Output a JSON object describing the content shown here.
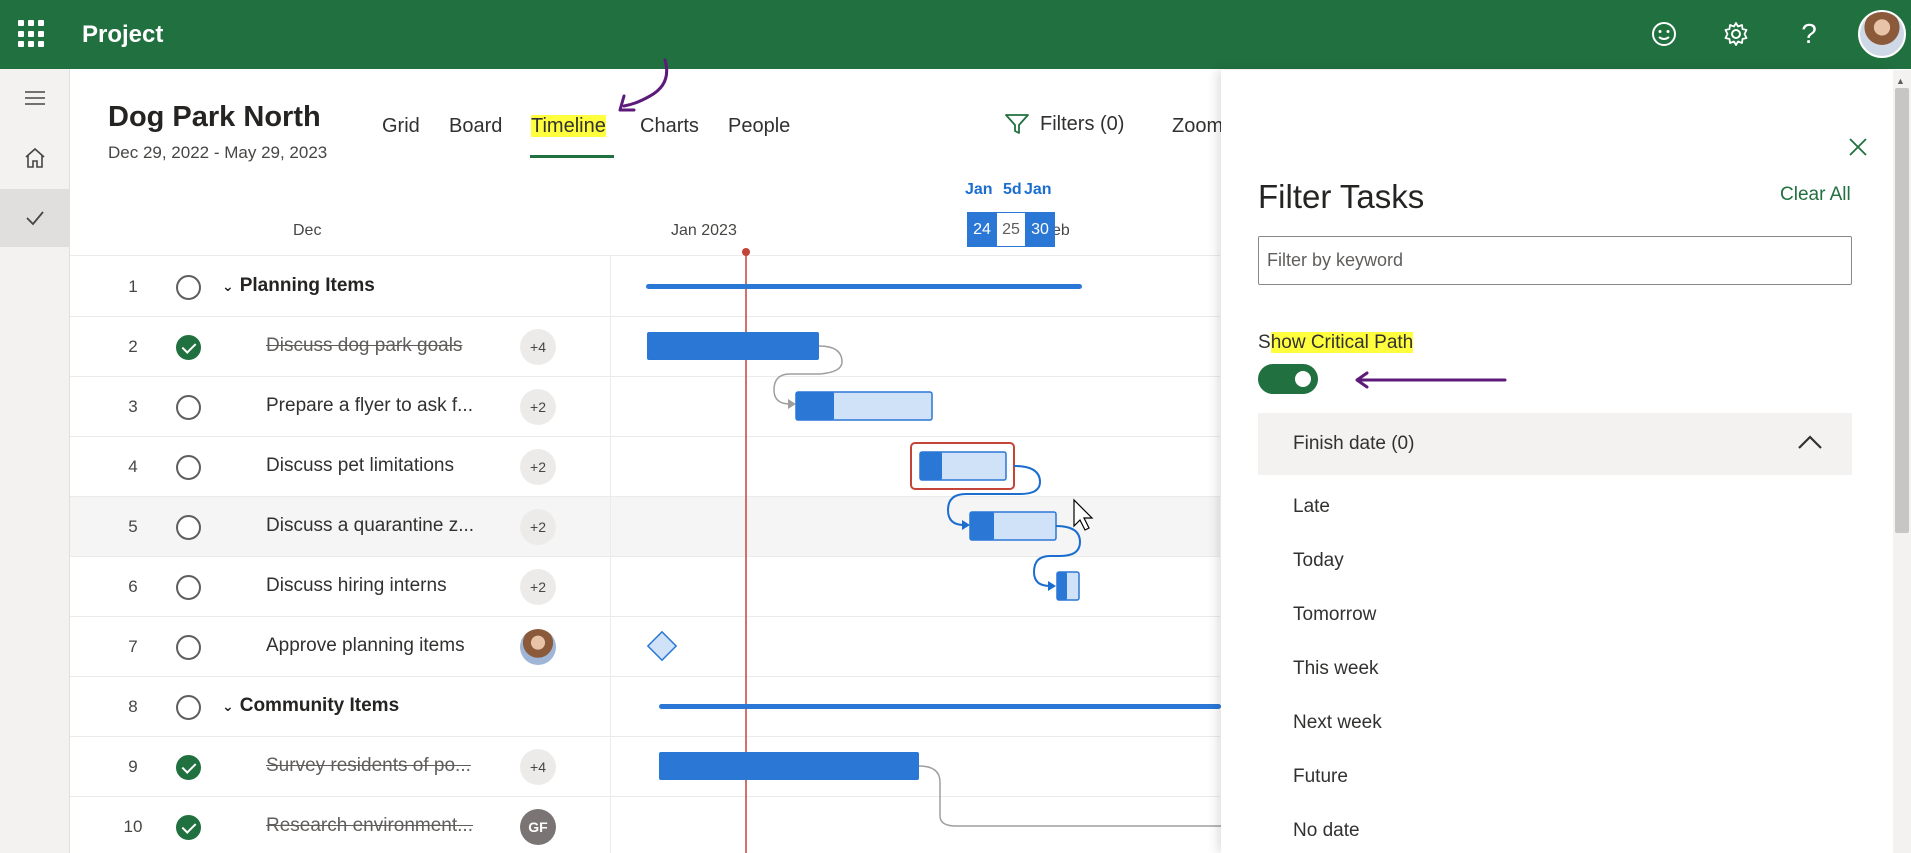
{
  "app": {
    "title": "Project"
  },
  "topbar": {
    "feedback_icon": "smiley-icon",
    "settings_icon": "gear-icon",
    "help_icon": "question-icon",
    "help_glyph": "?"
  },
  "project": {
    "title": "Dog Park North",
    "dates": "Dec 29, 2022 - May 29, 2023"
  },
  "tabs": [
    {
      "label": "Grid"
    },
    {
      "label": "Board"
    },
    {
      "label": "Timeline",
      "active": true
    },
    {
      "label": "Charts"
    },
    {
      "label": "People"
    }
  ],
  "toolbar": {
    "filters_label": "Filters (0)",
    "zoom_label": "Zoom"
  },
  "timeline": {
    "months": [
      "Dec",
      "Jan 2023",
      "eb"
    ],
    "marker_labels": {
      "jan_left": "Jan",
      "span": "5d",
      "jan_right": "Jan"
    },
    "date_chips": [
      "24",
      "25",
      "30"
    ]
  },
  "tasks": [
    {
      "num": "1",
      "name": "Planning Items",
      "group": true,
      "done": false,
      "badge": ""
    },
    {
      "num": "2",
      "name": "Discuss dog park goals",
      "group": false,
      "done": true,
      "badge": "+4"
    },
    {
      "num": "3",
      "name": "Prepare a flyer to ask f...",
      "group": false,
      "done": false,
      "badge": "+2"
    },
    {
      "num": "4",
      "name": "Discuss pet limitations",
      "group": false,
      "done": false,
      "badge": "+2"
    },
    {
      "num": "5",
      "name": "Discuss a quarantine z...",
      "group": false,
      "done": false,
      "badge": "+2"
    },
    {
      "num": "6",
      "name": "Discuss hiring interns",
      "group": false,
      "done": false,
      "badge": "+2"
    },
    {
      "num": "7",
      "name": "Approve planning items",
      "group": false,
      "done": false,
      "badge": ""
    },
    {
      "num": "8",
      "name": "Community Items",
      "group": true,
      "done": false,
      "badge": ""
    },
    {
      "num": "9",
      "name": "Survey residents of po...",
      "group": false,
      "done": true,
      "badge": "+4"
    },
    {
      "num": "10",
      "name": "Research environment...",
      "group": false,
      "done": true,
      "badge": "GF"
    }
  ],
  "filter_panel": {
    "title": "Filter Tasks",
    "clear_all": "Clear All",
    "keyword_placeholder": "Filter by keyword",
    "critical_path_label_prefix": "S",
    "critical_path_label_rest": "how Critical Path",
    "critical_path_on": true,
    "section_title": "Finish date (0)",
    "options": [
      "Late",
      "Today",
      "Tomorrow",
      "This week",
      "Next week",
      "Future",
      "No date"
    ]
  },
  "colors": {
    "brand_green": "#21703f",
    "bar_blue": "#2b77d6",
    "bar_light": "#cfe2f8",
    "highlight": "#ffff3d",
    "annotation_purple": "#5c1a7a",
    "today_line": "#c4443a"
  }
}
